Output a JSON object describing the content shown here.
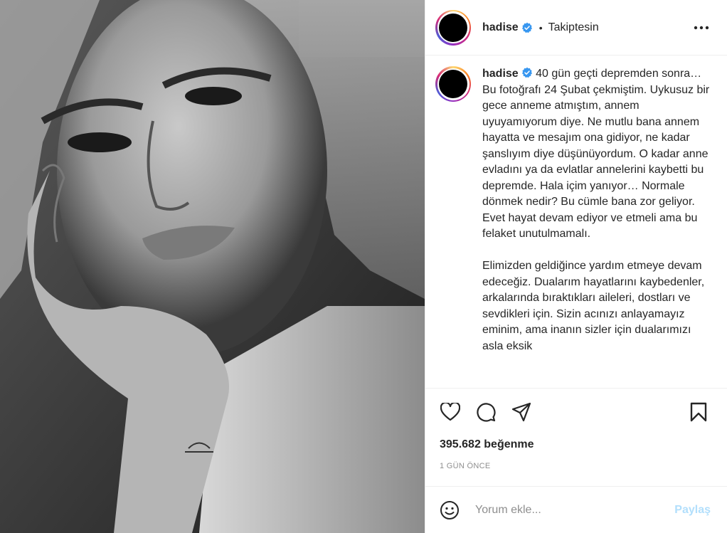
{
  "post": {
    "username": "hadise",
    "verified": true,
    "separator": "•",
    "follow_status": "Takiptesin",
    "more_icon": "more-horizontal-icon"
  },
  "caption": {
    "username": "hadise",
    "text": "40 gün geçti depremden sonra… Bu fotoğrafı 24 Şubat çekmiştim. Uykusuz bir gece anneme atmıştım, annem uyuyamıyorum diye. Ne mutlu bana annem hayatta ve mesajım ona gidiyor, ne kadar şanslıyım diye düşünüyordum. O kadar anne evladını ya da evlatlar annelerini kaybetti bu depremde. Hala içim yanıyor… Normale dönmek nedir? Bu cümle bana zor geliyor. Evet hayat devam ediyor ve etmeli ama bu felaket unutulmamalı.\n\nElimizden geldiğince yardım etmeye devam edeceğiz. Dualarım hayatlarını kaybedenler, arkalarında bıraktıkları aileleri, dostları ve sevdikleri için. Sizin acınızı anlayamayız eminim, ama inanın sizler için dualarımızı asla eksik"
  },
  "actions": {
    "like_icon": "heart-icon",
    "comment_icon": "comment-icon",
    "share_icon": "send-icon",
    "save_icon": "bookmark-icon"
  },
  "stats": {
    "likes": "395.682 beğenme",
    "time": "1 GÜN ÖNCE"
  },
  "comment_box": {
    "emoji_icon": "emoji-icon",
    "placeholder": "Yorum ekle...",
    "post_label": "Paylaş"
  },
  "colors": {
    "verified_blue": "#3897f0",
    "post_button_disabled": "#b2dffc",
    "muted_text": "#8e8e8e"
  }
}
